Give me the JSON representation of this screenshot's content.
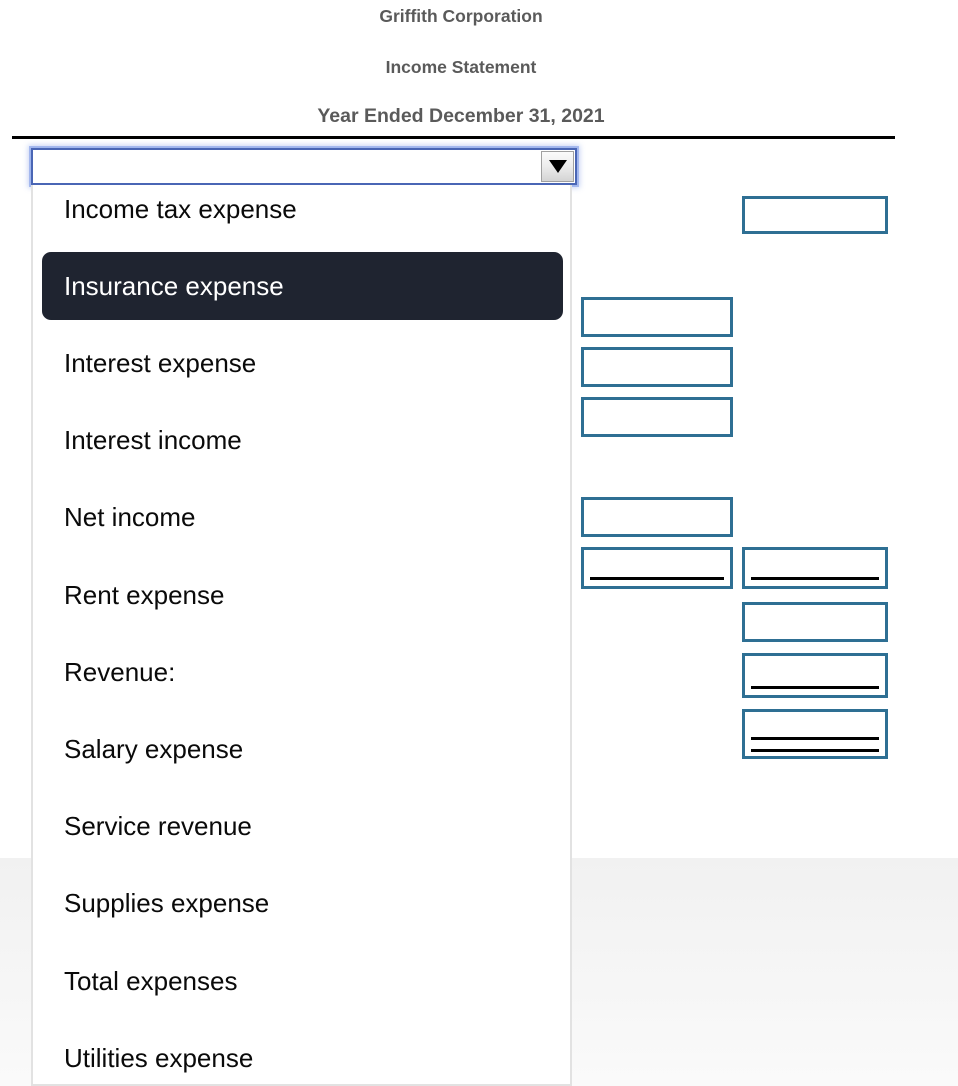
{
  "statement": {
    "company": "Griffith Corporation",
    "title": "Income Statement",
    "period": "Year Ended December 31, 2021"
  },
  "select": {
    "name": "line-item-account-select",
    "value": "",
    "placeholder": "",
    "expanded": true,
    "arrow_icon": "chevron-down-icon",
    "selected_option": "Insurance expense",
    "options": [
      "Income tax expense",
      "Insurance expense",
      "Interest expense",
      "Interest income",
      "Net income",
      "Rent expense",
      "Revenue:",
      "Salary expense",
      "Service revenue",
      "Supplies expense",
      "Total expenses",
      "Utilities expense"
    ]
  },
  "colors": {
    "input_border": "#2e6f93",
    "highlight_bg": "#1f2430",
    "highlight_text": "#ffffff",
    "heading_text": "#5a5a5a",
    "focus_ring": "#4a66b5",
    "rule": "#000000"
  },
  "description_inputs": [
    {
      "value": "",
      "placeholder": ""
    },
    {
      "value": "",
      "placeholder": ""
    },
    {
      "value": "",
      "placeholder": ""
    },
    {
      "value": "",
      "placeholder": ""
    },
    {
      "value": "",
      "placeholder": ""
    },
    {
      "value": "",
      "placeholder": ""
    },
    {
      "value": "",
      "placeholder": ""
    },
    {
      "value": "",
      "placeholder": ""
    },
    {
      "value": "",
      "placeholder": ""
    },
    {
      "value": "",
      "placeholder": ""
    }
  ],
  "amount_inputs_left": [
    {
      "value": "",
      "placeholder": "",
      "rule": "none"
    },
    {
      "value": "",
      "placeholder": "",
      "rule": "none"
    },
    {
      "value": "",
      "placeholder": "",
      "rule": "none"
    },
    {
      "value": "",
      "placeholder": "",
      "rule": "none"
    },
    {
      "value": "",
      "placeholder": "",
      "rule": "single"
    }
  ],
  "amount_inputs_right": [
    {
      "value": "",
      "placeholder": "",
      "rule": "none"
    },
    {
      "value": "",
      "placeholder": "",
      "rule": "single"
    },
    {
      "value": "",
      "placeholder": "",
      "rule": "none"
    },
    {
      "value": "",
      "placeholder": "",
      "rule": "single"
    },
    {
      "value": "",
      "placeholder": "",
      "rule": "double"
    }
  ]
}
